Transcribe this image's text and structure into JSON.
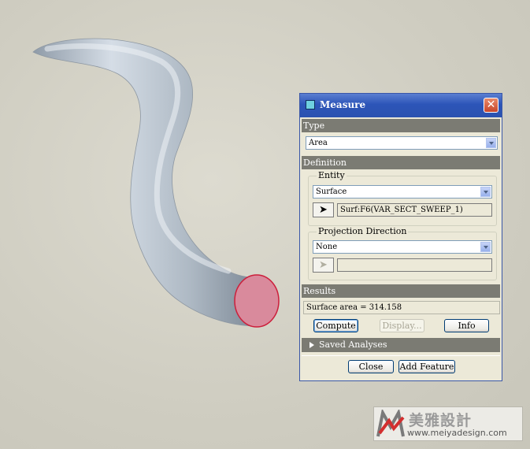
{
  "dialog": {
    "title": "Measure",
    "close_glyph": "✕",
    "type_section": {
      "label": "Type",
      "selected": "Area"
    },
    "definition_section": {
      "label": "Definition",
      "entity": {
        "label": "Entity",
        "selected": "Surface",
        "selection": "Surf:F6(VAR_SECT_SWEEP_1)"
      },
      "projection": {
        "label": "Projection Direction",
        "selected": "None",
        "selection": ""
      }
    },
    "results_section": {
      "label": "Results",
      "value": "Surface area = 314.158",
      "buttons": {
        "compute": "Compute",
        "display": "Display...",
        "info": "Info"
      }
    },
    "saved_analyses": {
      "label": "Saved Analyses"
    },
    "footer": {
      "close": "Close",
      "add_feature": "Add Feature"
    }
  },
  "watermark": {
    "text": "美雅設計",
    "url": "www.meiyadesign.com"
  },
  "colors": {
    "titlebar": "#2c55b8",
    "section_bar": "#7b7b73",
    "dialog_bg": "#ece9d8",
    "model_body": "#b7c2cc",
    "model_end_face": "#d98a9c",
    "model_end_edge": "#cc1f3b"
  },
  "icons": {
    "picker": "arrow-cursor-icon",
    "collapse": "triangle-right-icon",
    "title": "window-icon"
  }
}
